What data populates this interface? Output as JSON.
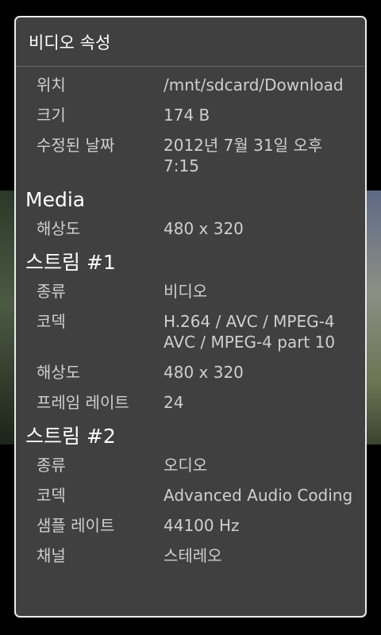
{
  "dialog": {
    "title": "비디오 속성"
  },
  "general": [
    {
      "label": "위치",
      "value": "/mnt/sdcard/Download"
    },
    {
      "label": "크기",
      "value": "174 B"
    },
    {
      "label": "수정된 날짜",
      "value": "2012년 7월 31일 오후 7:15"
    }
  ],
  "media": {
    "title": "Media",
    "rows": [
      {
        "label": "해상도",
        "value": "480 x 320"
      }
    ]
  },
  "stream1": {
    "title": "스트림 #1",
    "rows": [
      {
        "label": "종류",
        "value": "비디오"
      },
      {
        "label": "코덱",
        "value": "H.264 / AVC / MPEG-4 AVC / MPEG-4 part 10"
      },
      {
        "label": "해상도",
        "value": "480 x 320"
      },
      {
        "label": "프레임 레이트",
        "value": "24"
      }
    ]
  },
  "stream2": {
    "title": "스트림 #2",
    "rows": [
      {
        "label": "종류",
        "value": "오디오"
      },
      {
        "label": "코덱",
        "value": "Advanced Audio Coding"
      },
      {
        "label": "샘플 레이트",
        "value": "44100 Hz"
      },
      {
        "label": "채널",
        "value": "스테레오"
      }
    ]
  }
}
